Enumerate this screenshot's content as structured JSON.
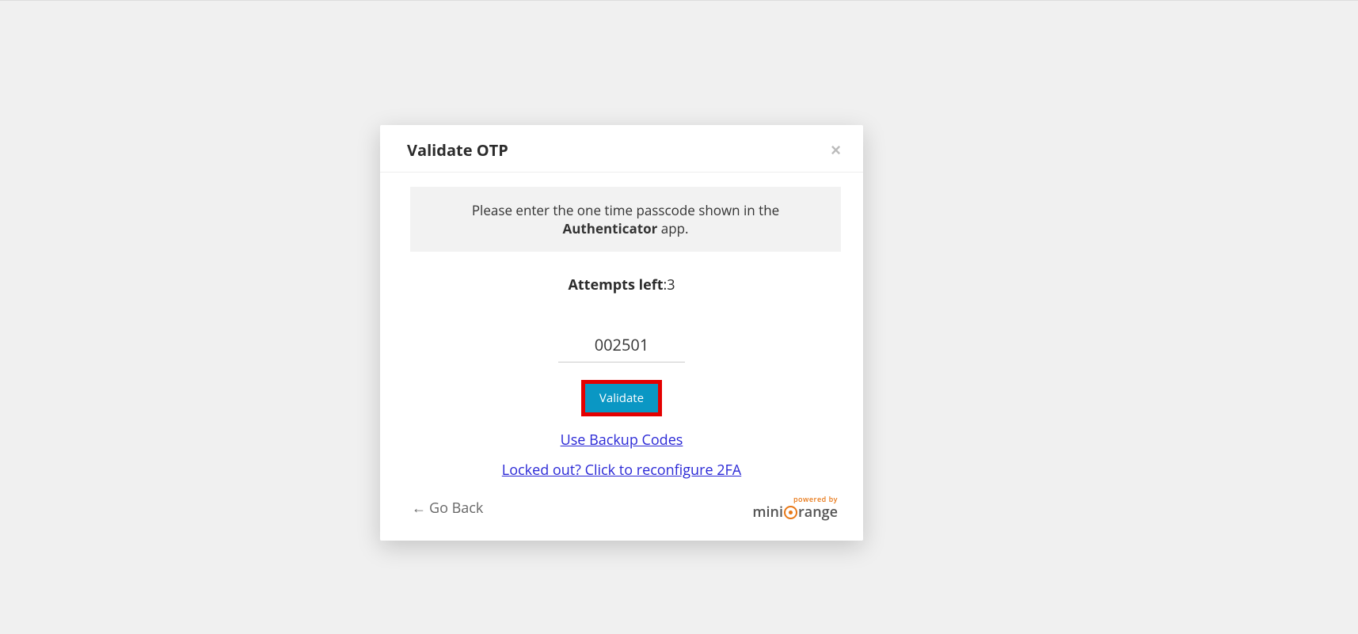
{
  "modal": {
    "title": "Validate OTP",
    "instruction_prefix": "Please enter the one time passcode shown in the ",
    "instruction_bold": "Authenticator",
    "instruction_suffix": " app.",
    "attempts_label": "Attempts left",
    "attempts_value": ":3",
    "otp_value": "002501",
    "validate_label": "Validate",
    "backup_codes_link": "Use Backup Codes",
    "locked_out_link": "Locked out? Click to reconfigure 2FA",
    "go_back_label": "Go Back",
    "powered_by": "powered by",
    "brand_mini": "mini",
    "brand_range": "range"
  }
}
